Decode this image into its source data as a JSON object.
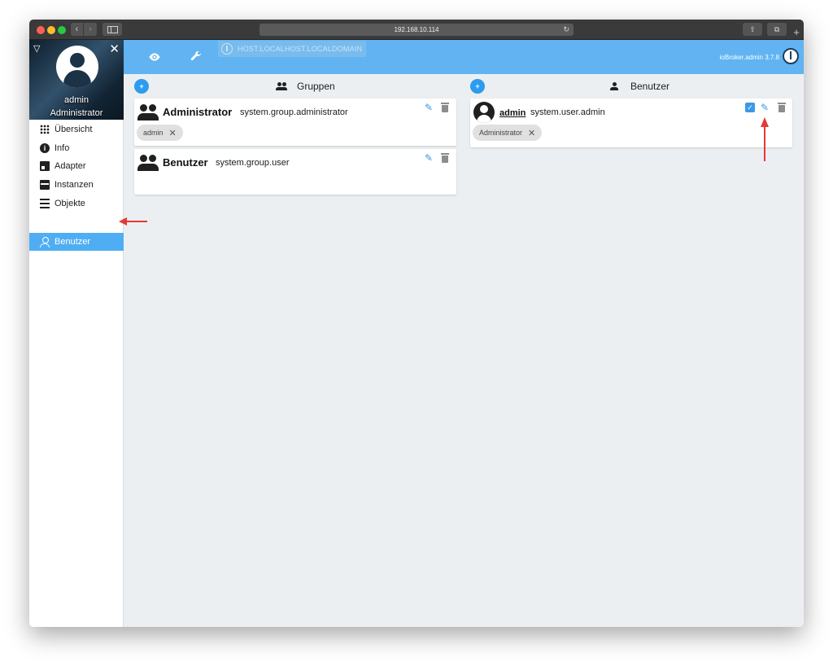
{
  "browser": {
    "url": "192.168.10.114",
    "reload_icon": "reload-icon",
    "share_icon": "share-icon",
    "tabs_icon": "tabs-icon",
    "back": "‹",
    "forward": "›",
    "newtab": "+"
  },
  "sidebar": {
    "user_name": "admin",
    "user_role": "Administrator",
    "items": [
      {
        "label": "Übersicht",
        "icon": "grid-icon",
        "active": false
      },
      {
        "label": "Info",
        "icon": "info-icon",
        "active": false
      },
      {
        "label": "Adapter",
        "icon": "store-icon",
        "active": false
      },
      {
        "label": "Instanzen",
        "icon": "instances-icon",
        "active": false
      },
      {
        "label": "Objekte",
        "icon": "list-icon",
        "active": false
      },
      {
        "label": "Benutzer",
        "icon": "user-icon",
        "active": true
      }
    ]
  },
  "topbar": {
    "host": "HOST.LOCALHOST.LOCALDOMAIN",
    "version": "ioBroker.admin 3.7.8",
    "accent_color": "#61b4f1"
  },
  "groups_panel": {
    "title": "Gruppen",
    "groups": [
      {
        "name": "Administrator",
        "id": "system.group.administrator",
        "members": [
          "admin"
        ]
      },
      {
        "name": "Benutzer",
        "id": "system.group.user",
        "members": []
      }
    ]
  },
  "users_panel": {
    "title": "Benutzer",
    "users": [
      {
        "name": "admin",
        "id": "system.user.admin",
        "enabled": true,
        "groups": [
          "Administrator"
        ]
      }
    ]
  },
  "chip_remove": "✕",
  "edit_glyph": "✎",
  "check_glyph": "✓",
  "add_group_glyph": "+👥",
  "add_user_glyph": "+"
}
